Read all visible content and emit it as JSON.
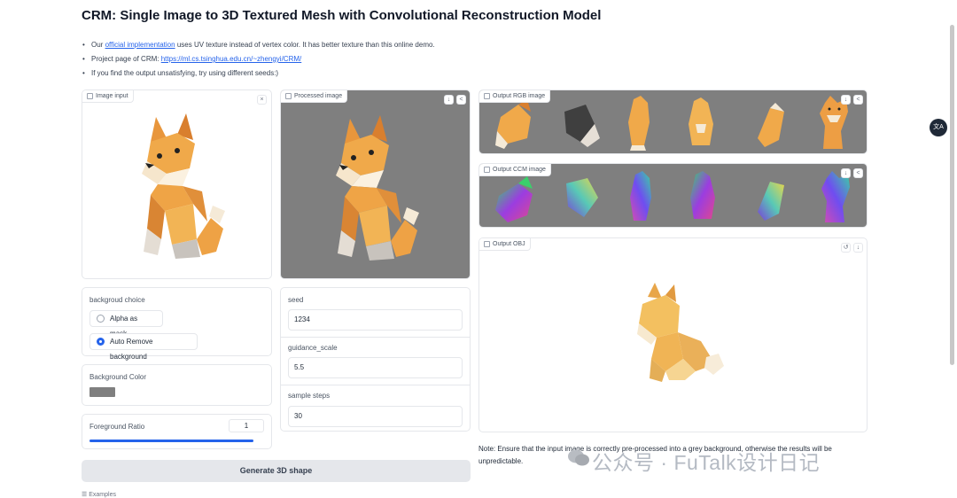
{
  "title": "CRM: Single Image to 3D Textured Mesh with Convolutional Reconstruction Model",
  "notes": {
    "line1_prefix": "Our",
    "line1_link": "official implementation",
    "line1_suffix": "uses UV texture instead of vertex color. It has better texture than this online demo.",
    "line2_prefix": "Project page of CRM:",
    "line2_link": "https://ml.cs.tsinghua.edu.cn/~zhengyi/CRM/",
    "line3": "If you find the output unsatisfying, try using different seeds:)"
  },
  "panels": {
    "image_input": "Image input",
    "processed_image": "Processed image",
    "output_rgb": "Output RGB image",
    "output_ccm": "Output CCM image",
    "output_obj": "Output OBJ"
  },
  "background_choice": {
    "label": "backgroud choice",
    "options": [
      "Alpha as mask",
      "Auto Remove background"
    ],
    "selected": "Auto Remove background"
  },
  "background_color": {
    "label": "Background Color",
    "value": "#7f7f7f"
  },
  "foreground_ratio": {
    "label": "Foreground Ratio",
    "value": "1",
    "fill_percent": 100
  },
  "seed": {
    "label": "seed",
    "value": "1234"
  },
  "guidance_scale": {
    "label": "guidance_scale",
    "value": "5.5"
  },
  "sample_steps": {
    "label": "sample steps",
    "value": "30"
  },
  "generate_button": "Generate 3D shape",
  "examples_label": "Examples",
  "note": "Note: Ensure that the input image is correctly pre-processed into a grey background, otherwise the results will be unpredictable.",
  "watermark": "公众号 · FuTalk设计日记",
  "translate_button": "文A",
  "icons": {
    "close": "×",
    "download": "↓",
    "share": "<",
    "reset": "↺"
  },
  "colors": {
    "accent": "#2563eb",
    "panel_grey": "#7f7f7f",
    "button_bg": "#e5e7eb"
  }
}
